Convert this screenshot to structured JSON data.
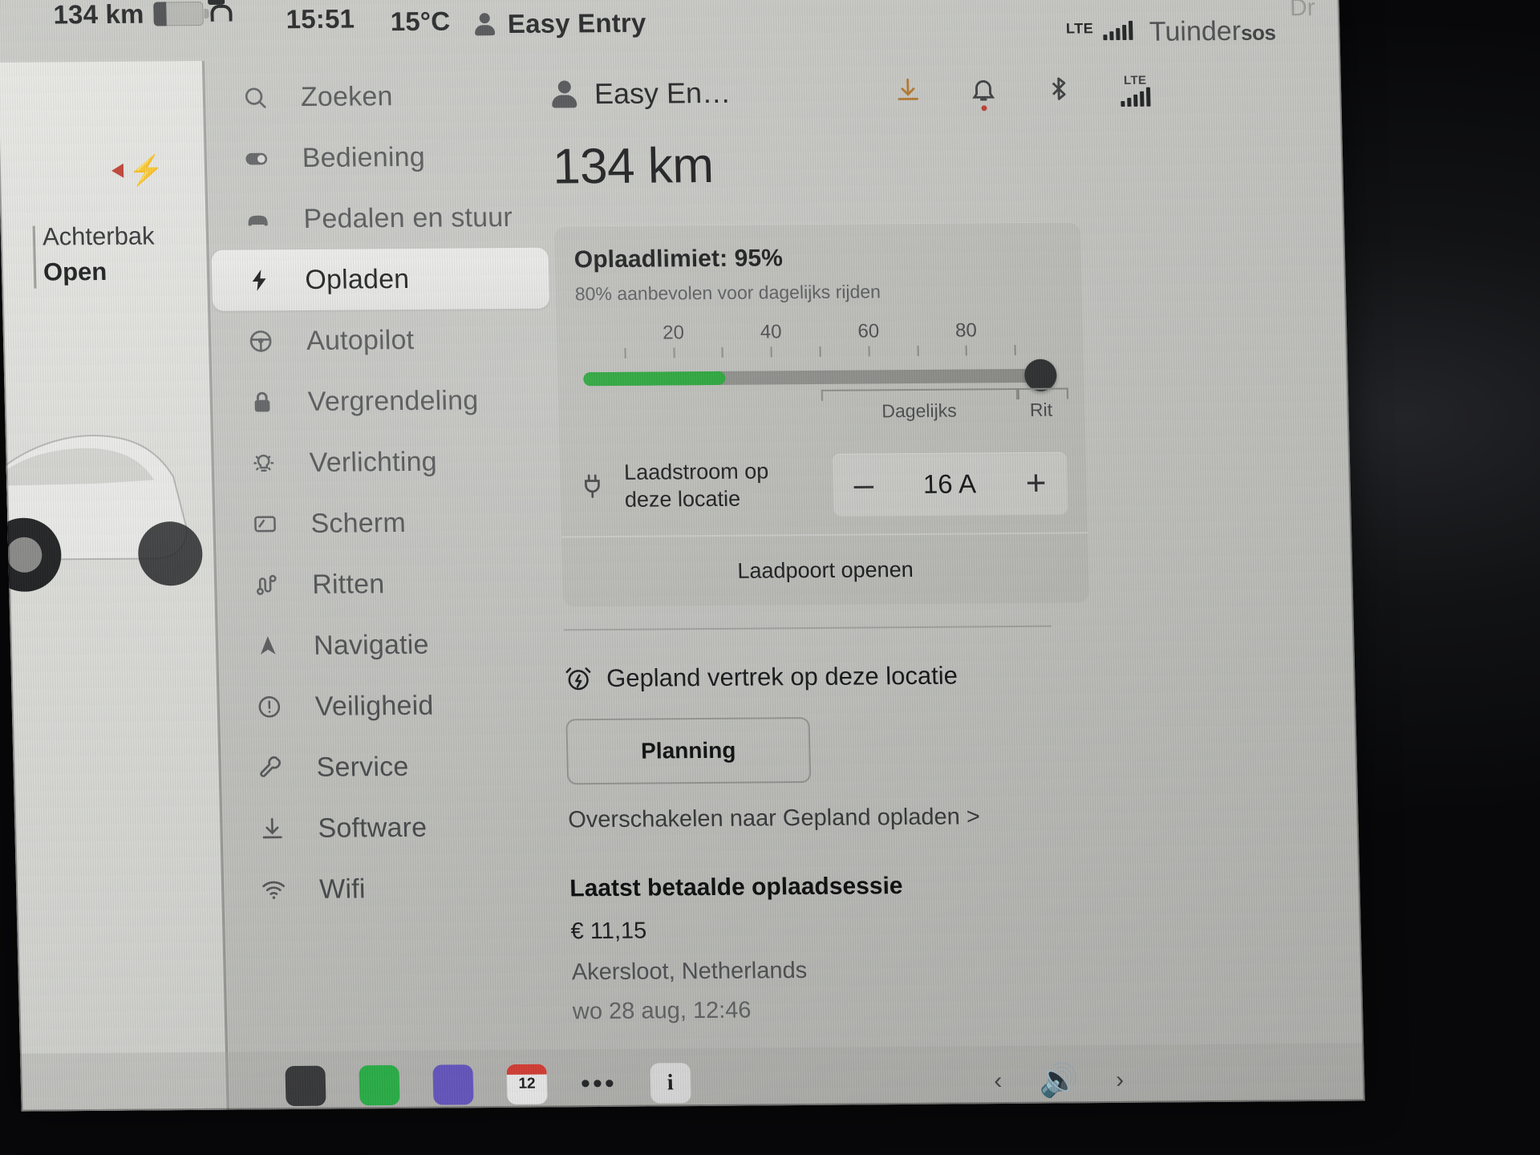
{
  "statusbar": {
    "range": "134 km",
    "lock_icon": "unlocked-padlock-icon",
    "time": "15:51",
    "temperature": "15°C",
    "profile": "Easy Entry",
    "lte_label": "LTE",
    "street": "Tuinder",
    "sos": "sos",
    "map_ghost": "Dr"
  },
  "map_panel": {
    "trunk_label": "Achterbak",
    "trunk_state": "Open",
    "charge_indicator": "charging-bolt-icon"
  },
  "sidebar": {
    "items": [
      {
        "label": "Zoeken",
        "icon": "search-icon",
        "active": false
      },
      {
        "label": "Bediening",
        "icon": "toggle-icon",
        "active": false
      },
      {
        "label": "Pedalen en stuur",
        "icon": "car-icon",
        "active": false
      },
      {
        "label": "Opladen",
        "icon": "bolt-icon",
        "active": true
      },
      {
        "label": "Autopilot",
        "icon": "steering-wheel-icon",
        "active": false
      },
      {
        "label": "Vergrendeling",
        "icon": "lock-icon",
        "active": false
      },
      {
        "label": "Verlichting",
        "icon": "lightbulb-icon",
        "active": false
      },
      {
        "label": "Scherm",
        "icon": "display-icon",
        "active": false
      },
      {
        "label": "Ritten",
        "icon": "trips-icon",
        "active": false
      },
      {
        "label": "Navigatie",
        "icon": "navigation-arrow-icon",
        "active": false
      },
      {
        "label": "Veiligheid",
        "icon": "warning-circle-icon",
        "active": false
      },
      {
        "label": "Service",
        "icon": "wrench-icon",
        "active": false
      },
      {
        "label": "Software",
        "icon": "download-icon",
        "active": false
      },
      {
        "label": "Wifi",
        "icon": "wifi-icon",
        "active": false
      }
    ]
  },
  "content": {
    "profile_name": "Easy En…",
    "header_icons": [
      {
        "name": "software-download-icon"
      },
      {
        "name": "bell-icon"
      },
      {
        "name": "bluetooth-icon"
      },
      {
        "name": "lte-signal-icon",
        "label": "LTE"
      }
    ],
    "range": "134 km",
    "charge_card": {
      "limit_title": "Oplaadlimiet: 95%",
      "limit_subtitle": "80% aanbevolen voor dagelijks rijden",
      "slider": {
        "value": 95,
        "min": 0,
        "max": 100,
        "tick_labels": [
          "20",
          "40",
          "60",
          "80"
        ],
        "tick_values": [
          20,
          40,
          60,
          80
        ],
        "fill_percent": 30,
        "segment_labels": [
          "Dagelijks",
          "Rit"
        ],
        "fill_color": "#1da830",
        "track_color": "#8d8e8a",
        "knob_color": "#2b2c2e"
      },
      "current": {
        "label_line1": "Laadstroom op",
        "label_line2": "deze locatie",
        "icon": "plug-icon",
        "decrement": "–",
        "value": "16 A",
        "increment": "+"
      },
      "open_port": "Laadpoort openen"
    },
    "departure": {
      "icon": "scheduled-departure-icon",
      "title": "Gepland vertrek op deze locatie",
      "button": "Planning",
      "switch_link": "Overschakelen naar Gepland opladen >"
    },
    "last_session": {
      "title": "Laatst betaalde oplaadsessie",
      "price": "€ 11,15",
      "location": "Akersloot, Netherlands",
      "date": "wo 28 aug, 12:46"
    }
  },
  "dock": {
    "items": [
      {
        "name": "media-icon"
      },
      {
        "name": "phone-icon"
      },
      {
        "name": "navigation-app-icon"
      },
      {
        "name": "calendar-icon",
        "value": "12"
      },
      {
        "name": "more-options-icon"
      },
      {
        "name": "info-icon"
      }
    ],
    "right": [
      {
        "name": "previous-track-icon",
        "glyph": "‹"
      },
      {
        "name": "volume-icon",
        "glyph": "🔊"
      },
      {
        "name": "next-track-icon",
        "glyph": "›"
      }
    ]
  }
}
